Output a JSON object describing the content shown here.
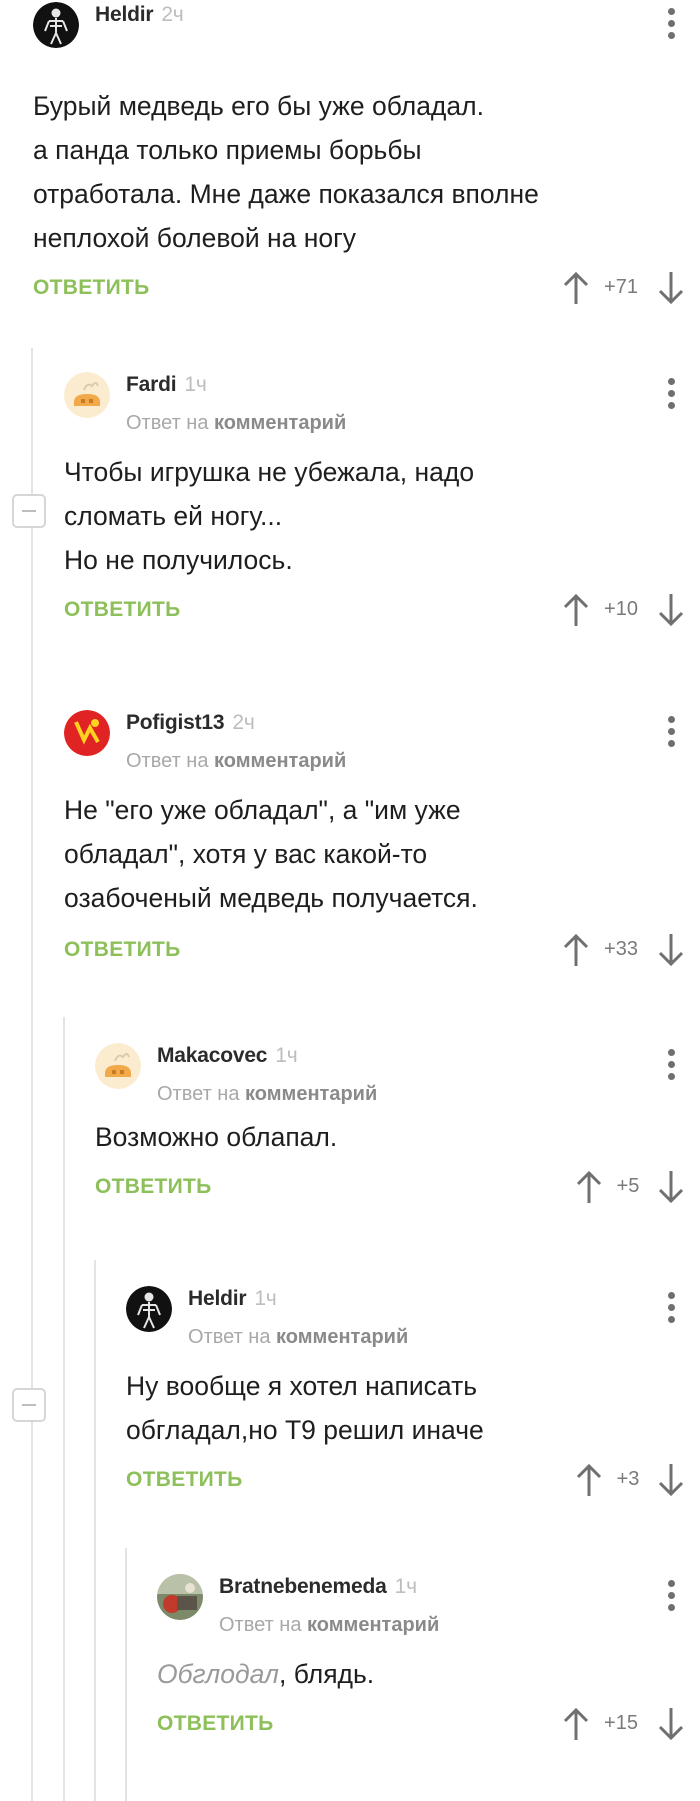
{
  "ui": {
    "reply_label": "ОТВЕТИТЬ",
    "reply_to_prefix": "Ответ на",
    "reply_to_link": "комментарий"
  },
  "colors": {
    "accent": "#8dc05a",
    "thread_line": "#e3e3e3",
    "text": "#1e1e1e",
    "muted": "#a8a8a8"
  },
  "comments": [
    {
      "author": "Heldir",
      "time": "2ч",
      "avatar_icon": "skeleton-avatar-icon",
      "lines": [
        "Бурый медведь его бы уже обладал.",
        "а панда только приемы борьбы",
        "отработала. Мне даже показался вполне",
        "неплохой болевой на ногу"
      ],
      "score": "+71"
    },
    {
      "author": "Fardi",
      "time": "1ч",
      "avatar_icon": "default-pie-avatar-icon",
      "lines": [
        "Чтобы игрушка не убежала, надо",
        "сломать ей ногу...",
        "Но не получилось."
      ],
      "score": "+10"
    },
    {
      "author": "Pofigist13",
      "time": "2ч",
      "avatar_icon": "red-yellow-avatar-icon",
      "lines": [
        "Не \"его уже обладал\", а \"им уже",
        "обладал\", хотя у вас какой-то",
        "озабоченый медведь получается."
      ],
      "score": "+33"
    },
    {
      "author": "Makacovec",
      "time": "1ч",
      "avatar_icon": "default-pie-avatar-icon",
      "lines": [
        "Возможно облапал."
      ],
      "score": "+5"
    },
    {
      "author": "Heldir",
      "time": "1ч",
      "avatar_icon": "skeleton-avatar-icon",
      "lines": [
        "Ну вообще я хотел написать",
        "обгладал,но Т9 решил иначе"
      ],
      "score": "+3"
    },
    {
      "author": "Bratnebenemeda",
      "time": "1ч",
      "avatar_icon": "photo-avatar-icon",
      "emphasis": "Обглодал",
      "rest": ", блядь.",
      "score": "+15"
    }
  ]
}
